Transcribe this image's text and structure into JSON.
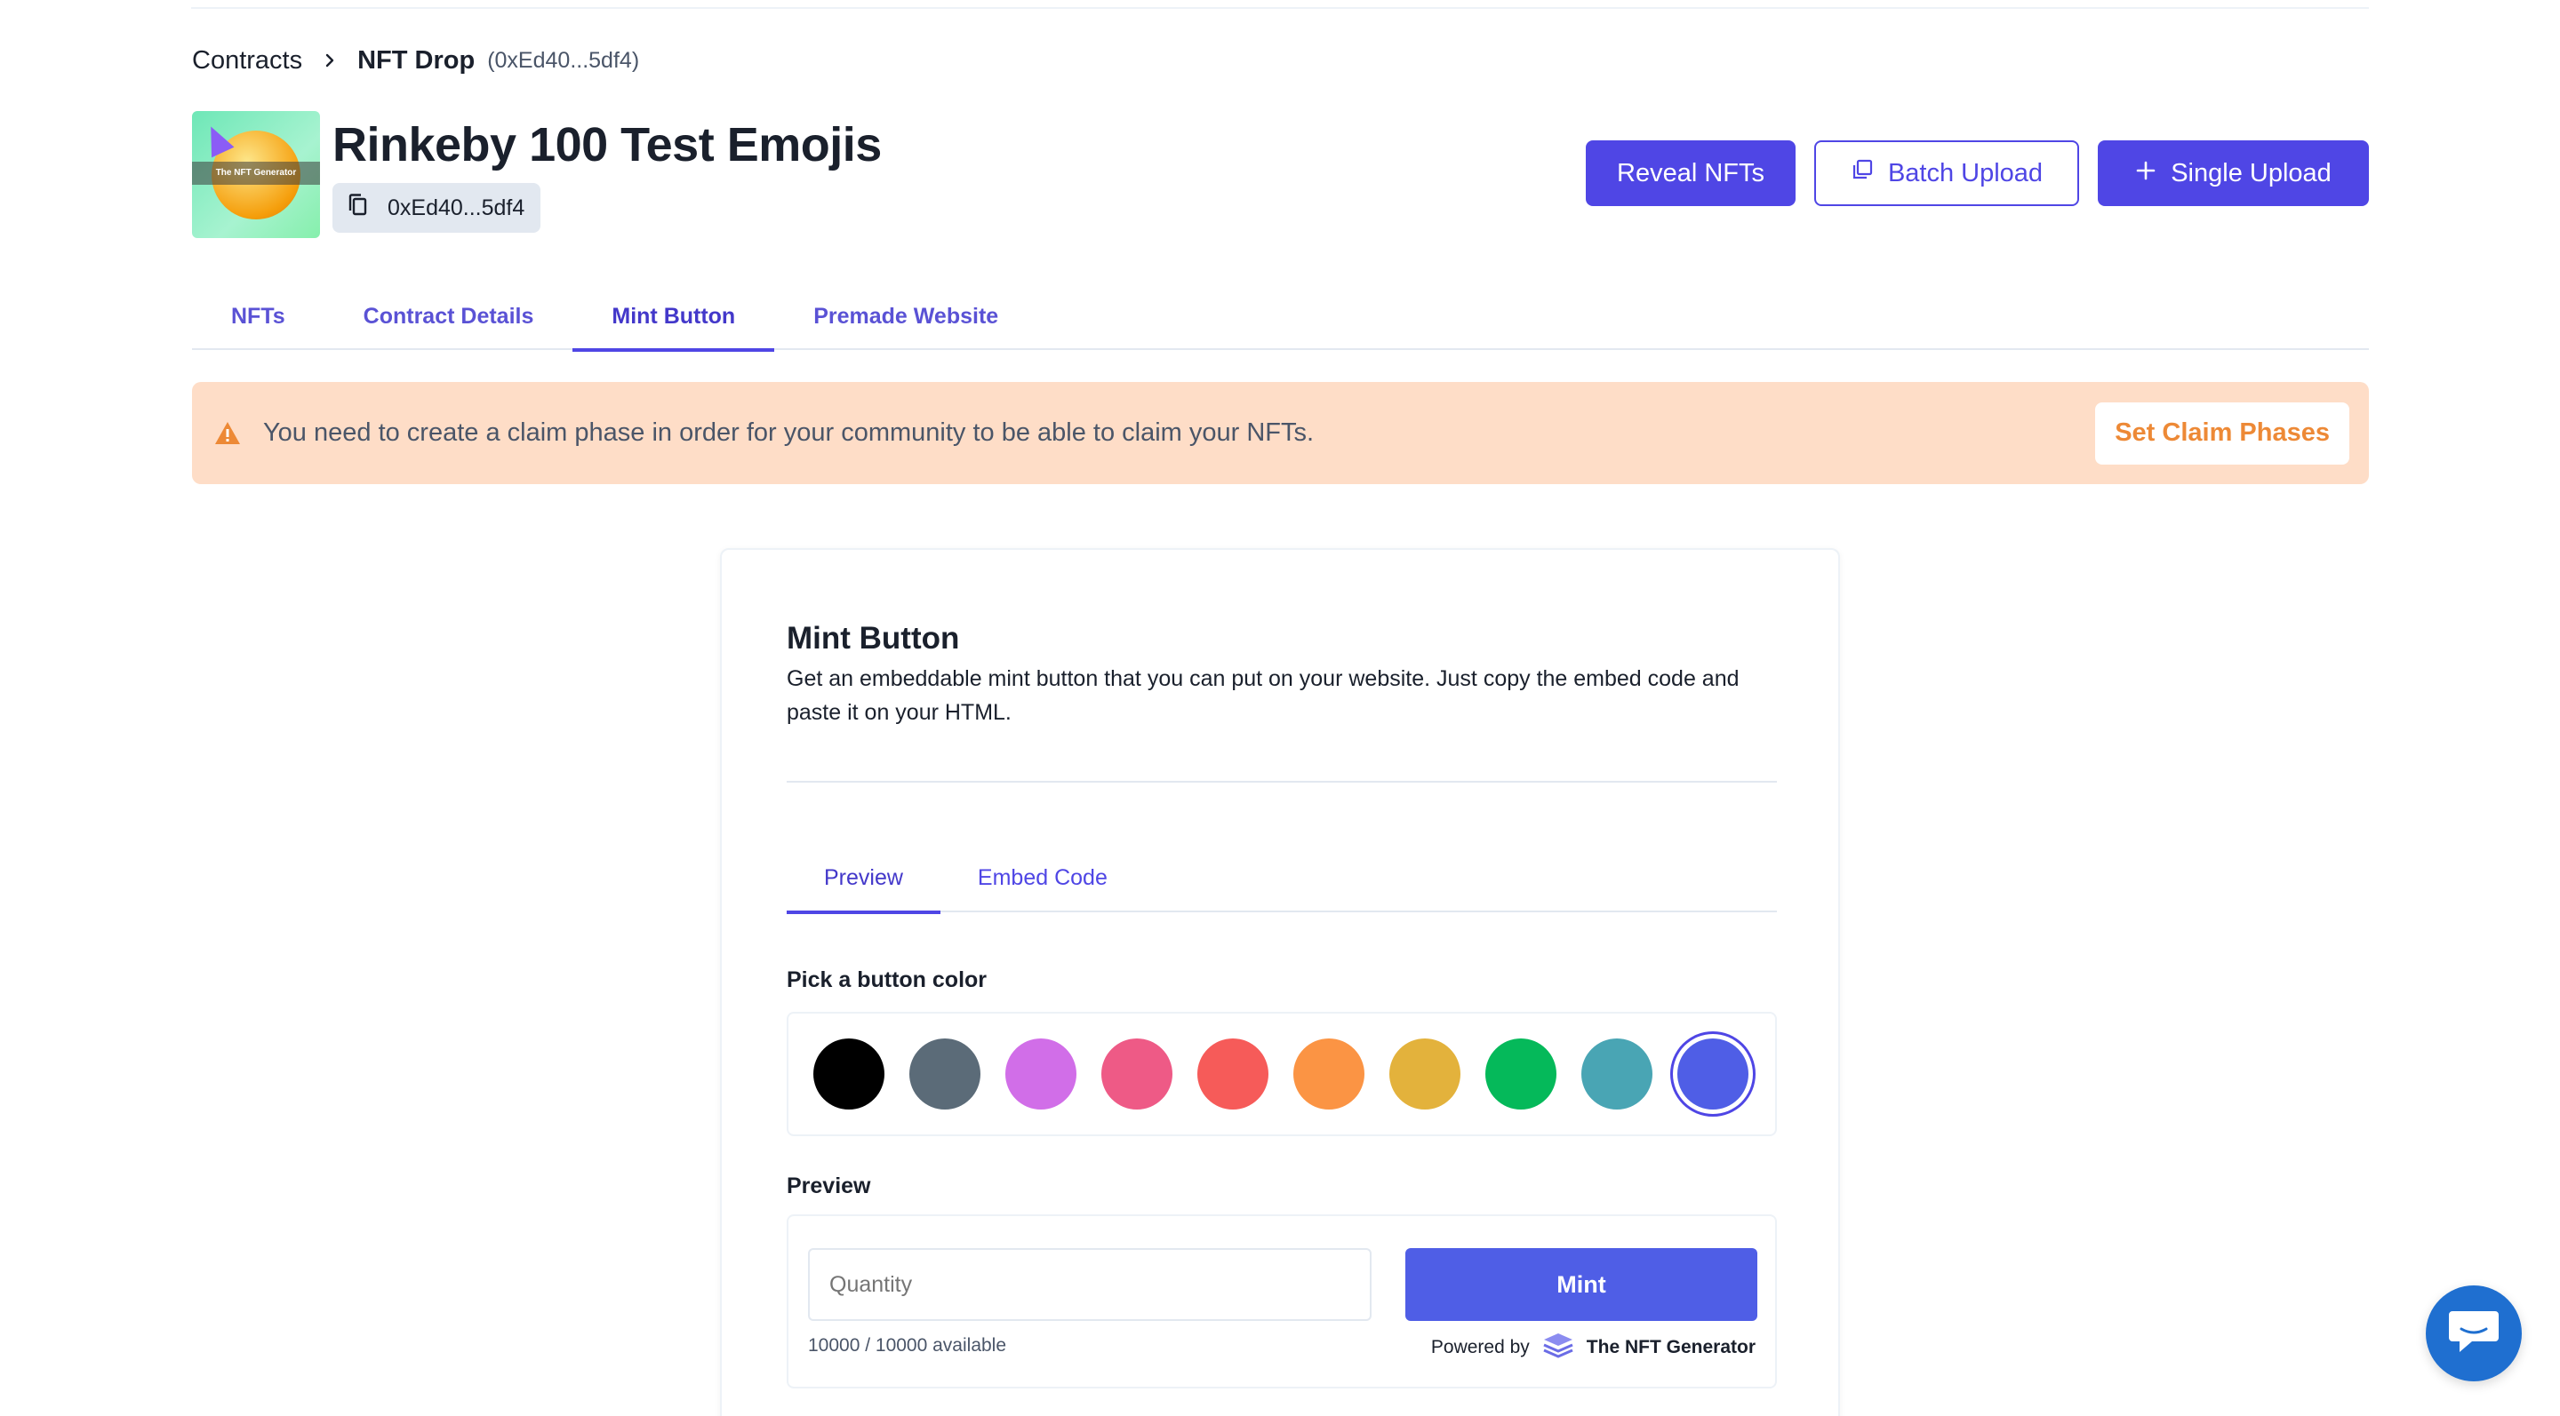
{
  "breadcrumb": {
    "contracts": "Contracts",
    "current": "NFT Drop",
    "address": "(0xEd40...5df4)"
  },
  "header": {
    "thumbnail_text": "The NFT Generator",
    "title": "Rinkeby 100 Test Emojis",
    "address": "0xEd40...5df4",
    "reveal_label": "Reveal NFTs",
    "batch_label": "Batch Upload",
    "single_label": "Single Upload"
  },
  "tabs": [
    {
      "label": "NFTs"
    },
    {
      "label": "Contract Details"
    },
    {
      "label": "Mint Button",
      "active": true
    },
    {
      "label": "Premade Website"
    }
  ],
  "alert": {
    "message": "You need to create a claim phase in order for your community to be able to claim your NFTs.",
    "action": "Set Claim Phases"
  },
  "mint_card": {
    "title": "Mint Button",
    "description": "Get an embeddable mint button that you can put on your website. Just copy the embed code and paste it on your HTML.",
    "tabs": [
      {
        "label": "Preview",
        "active": true
      },
      {
        "label": "Embed Code"
      }
    ],
    "pick_label": "Pick a button color",
    "colors": [
      "#000000",
      "#5b6b78",
      "#d16ee8",
      "#ee5a86",
      "#f65b59",
      "#fb9444",
      "#e3b23c",
      "#05b95a",
      "#49a5b4",
      "#4f5ee6"
    ],
    "selected_color": "#4f5ee6",
    "preview_label": "Preview",
    "quantity_placeholder": "Quantity",
    "mint_label": "Mint",
    "availability": "10000 / 10000 available",
    "powered_by": "Powered by",
    "brand": "The NFT Generator"
  },
  "colors": {
    "accent": "#4f46e5",
    "alert_bg": "#feddc7",
    "alert_accent": "#ed8936",
    "chat_bg": "#1f6fd0"
  }
}
